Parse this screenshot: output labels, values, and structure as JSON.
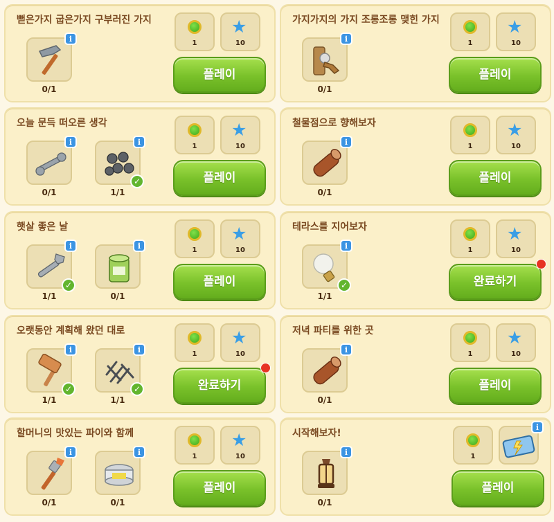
{
  "quests": [
    {
      "title": "뻗은가지 굽은가지 구부러진 가지",
      "items": [
        {
          "icon": "hammer-icon",
          "count": "0/1",
          "done": false
        }
      ],
      "rewards": [
        "1",
        "10"
      ],
      "reward_icons": [
        "gem-icon",
        "star-icon"
      ],
      "button": "플레이",
      "notify": false
    },
    {
      "title": "가지가지의 가지 조롱조롱 맺힌 가지",
      "items": [
        {
          "icon": "faucet-icon",
          "count": "0/1",
          "done": false
        }
      ],
      "rewards": [
        "1",
        "10"
      ],
      "reward_icons": [
        "gem-icon",
        "star-icon"
      ],
      "button": "플레이",
      "notify": false
    },
    {
      "title": "오늘 문득 떠오른 생각",
      "items": [
        {
          "icon": "wrench-icon",
          "count": "0/1",
          "done": false
        },
        {
          "icon": "bolts-icon",
          "count": "1/1",
          "done": true
        }
      ],
      "rewards": [
        "1",
        "10"
      ],
      "reward_icons": [
        "gem-icon",
        "star-icon"
      ],
      "button": "플레이",
      "notify": false
    },
    {
      "title": "철물점으로 향해보자",
      "items": [
        {
          "icon": "log-icon",
          "count": "0/1",
          "done": false
        }
      ],
      "rewards": [
        "1",
        "10"
      ],
      "reward_icons": [
        "gem-icon",
        "star-icon"
      ],
      "button": "플레이",
      "notify": false
    },
    {
      "title": "햇살 좋은 날",
      "items": [
        {
          "icon": "adjustable-wrench-icon",
          "count": "1/1",
          "done": true
        },
        {
          "icon": "paint-can-icon",
          "count": "0/1",
          "done": false
        }
      ],
      "rewards": [
        "1",
        "10"
      ],
      "reward_icons": [
        "gem-icon",
        "star-icon"
      ],
      "button": "플레이",
      "notify": false
    },
    {
      "title": "테라스를 지어보자",
      "items": [
        {
          "icon": "light-bulb-icon",
          "count": "1/1",
          "done": true
        }
      ],
      "rewards": [
        "1",
        "10"
      ],
      "reward_icons": [
        "gem-icon",
        "star-icon"
      ],
      "button": "완료하기",
      "notify": true
    },
    {
      "title": "오랫동안 계획해 왔던 대로",
      "items": [
        {
          "icon": "mallet-icon",
          "count": "1/1",
          "done": true
        },
        {
          "icon": "nails-icon",
          "count": "1/1",
          "done": true
        }
      ],
      "rewards": [
        "1",
        "10"
      ],
      "reward_icons": [
        "gem-icon",
        "star-icon"
      ],
      "button": "완료하기",
      "notify": true
    },
    {
      "title": "저녁 파티를 위한 곳",
      "items": [
        {
          "icon": "log-icon",
          "count": "0/1",
          "done": false
        }
      ],
      "rewards": [
        "1",
        "10"
      ],
      "reward_icons": [
        "gem-icon",
        "star-icon"
      ],
      "button": "플레이",
      "notify": false
    },
    {
      "title": "할머니의 맛있는 파이와 함께",
      "items": [
        {
          "icon": "paintbrush-icon",
          "count": "0/1",
          "done": false
        },
        {
          "icon": "paint-tin-icon",
          "count": "0/1",
          "done": false
        }
      ],
      "rewards": [
        "1",
        "10"
      ],
      "reward_icons": [
        "gem-icon",
        "star-icon"
      ],
      "button": "플레이",
      "notify": false
    },
    {
      "title": "시작해보자!",
      "items": [
        {
          "icon": "lantern-icon",
          "count": "0/1",
          "done": false
        }
      ],
      "rewards": [
        "1",
        ""
      ],
      "reward_icons": [
        "gem-icon",
        "toolbox-icon"
      ],
      "button": "플레이",
      "notify": false
    }
  ],
  "info_glyph": "i",
  "check_glyph": "✓",
  "colors": {
    "card": "#fbf0c9",
    "button": "#79c12a",
    "info": "#3b94e3",
    "title": "#7a4a22"
  }
}
